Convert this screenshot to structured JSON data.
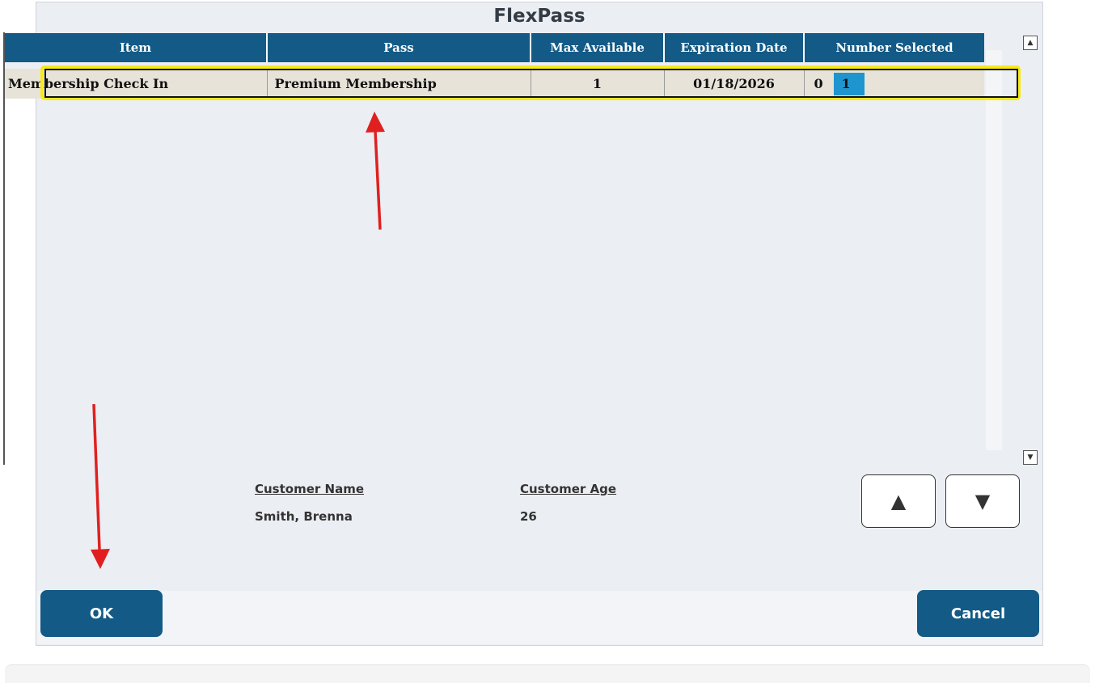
{
  "dialog": {
    "title": "FlexPass"
  },
  "grid": {
    "columns": [
      "Item",
      "Pass",
      "Max Available",
      "Expiration Date",
      "Number Selected"
    ],
    "rows": [
      {
        "item": "Membership Check In",
        "pass": "Premium Membership",
        "max_available": "1",
        "expiration_date": "01/18/2026",
        "selected_options": [
          "0",
          "1"
        ],
        "selected_value": "1"
      }
    ],
    "scroll_up": "▲",
    "scroll_down": "▼"
  },
  "customer": {
    "name_label": "Customer Name",
    "name_value": "Smith, Brenna",
    "age_label": "Customer Age",
    "age_value": "26"
  },
  "nav": {
    "up_glyph": "▲",
    "down_glyph": "▼"
  },
  "buttons": {
    "ok_label": "OK",
    "cancel_label": "Cancel"
  },
  "colors": {
    "header_bg": "#135a86",
    "highlight": "#f7e81a",
    "selected_cell": "#1e95cf",
    "annotation_arrow": "#e02020"
  }
}
